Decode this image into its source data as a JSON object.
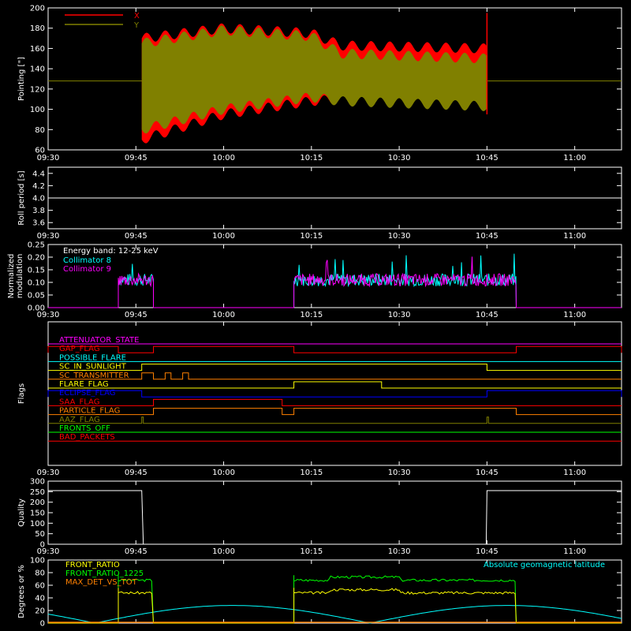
{
  "time_ticks": [
    "09:30",
    "09:45",
    "10:00",
    "10:15",
    "10:30",
    "10:45",
    "11:00"
  ],
  "chart_data": [
    {
      "id": "pointing",
      "type": "line",
      "ylabel": "Pointing [\"]",
      "ylim": [
        60,
        200
      ],
      "yticks": [
        60,
        80,
        100,
        120,
        140,
        160,
        180,
        200
      ],
      "x_range": [
        "09:30",
        "11:08"
      ],
      "series": [
        {
          "name": "X",
          "color": "#ff0000"
        },
        {
          "name": "Y",
          "color": "#808000"
        }
      ],
      "segments": [
        {
          "t": "09:46",
          "x_top": 170,
          "x_bottom": 70,
          "y_top": 165,
          "y_bottom": 80
        },
        {
          "t": "10:00",
          "x_top": 180,
          "x_bottom": 95,
          "y_top": 178,
          "y_bottom": 100
        },
        {
          "t": "10:15",
          "x_top": 175,
          "x_bottom": 108,
          "y_top": 172,
          "y_bottom": 112
        },
        {
          "t": "10:20",
          "x_top": 163,
          "x_bottom": 110,
          "y_top": 155,
          "y_bottom": 108
        },
        {
          "t": "10:45",
          "x_top": 160,
          "x_bottom": 105,
          "y_top": 150,
          "y_bottom": 103
        }
      ],
      "baseline": 128
    },
    {
      "id": "roll",
      "type": "line",
      "ylabel": "Roll period [s]",
      "ylim": [
        3.5,
        4.5
      ],
      "yticks": [
        3.6,
        3.8,
        4.0,
        4.2,
        4.4
      ],
      "value": 4.0
    },
    {
      "id": "modulation",
      "type": "line",
      "ylabel": "Normalized modulation",
      "ylim": [
        0,
        0.25
      ],
      "yticks": [
        0.0,
        0.05,
        0.1,
        0.15,
        0.2,
        0.25
      ],
      "title": "Energy band: 12-25 keV",
      "series": [
        {
          "name": "Collimator 8",
          "color": "#00ffff"
        },
        {
          "name": "Collimator 9",
          "color": "#ff00ff"
        }
      ],
      "active_intervals": [
        {
          "start": "09:42",
          "end": "09:48",
          "level": 0.11
        },
        {
          "start": "10:12",
          "end": "10:50",
          "level": 0.11
        }
      ]
    },
    {
      "id": "flags",
      "type": "line",
      "ylabel": "Flags",
      "flags": [
        {
          "name": "ATTENUATOR_STATE",
          "color": "#ff00ff",
          "high": []
        },
        {
          "name": "GAP_FLAG",
          "color": "#ff0000",
          "high": [
            [
              "09:30",
              "09:42"
            ],
            [
              "09:48",
              "10:12"
            ],
            [
              "10:50",
              "11:08"
            ]
          ]
        },
        {
          "name": "POSSIBLE_FLARE",
          "color": "#00ffff",
          "high": []
        },
        {
          "name": "SC_IN_SUNLIGHT",
          "color": "#ffff00",
          "high": [
            [
              "09:46",
              "10:45"
            ]
          ]
        },
        {
          "name": "SC_TRANSMITTER",
          "color": "#ff8000",
          "high": [
            [
              "09:46",
              "09:48"
            ],
            [
              "09:50",
              "09:51"
            ],
            [
              "09:53",
              "09:54"
            ]
          ]
        },
        {
          "name": "FLARE_FLAG",
          "color": "#ffff00",
          "high": [
            [
              "10:12",
              "10:27"
            ]
          ]
        },
        {
          "name": "ECLIPSE_FLAG",
          "color": "#0000ff",
          "high": [
            [
              "09:30",
              "09:46"
            ],
            [
              "10:45",
              "11:08"
            ]
          ]
        },
        {
          "name": "SAA_FLAG",
          "color": "#ff0000",
          "high": [
            [
              "09:48",
              "10:10"
            ]
          ]
        },
        {
          "name": "PARTICLE_FLAG",
          "color": "#ff8000",
          "high": [
            [
              "09:48",
              "10:10"
            ],
            [
              "10:12",
              "10:50"
            ]
          ]
        },
        {
          "name": "AAZ_FLAG",
          "color": "#808000",
          "high": [
            [
              "09:46",
              "09:46"
            ],
            [
              "10:45",
              "10:45"
            ]
          ]
        },
        {
          "name": "FRONTS_OFF",
          "color": "#00ff00",
          "high": []
        },
        {
          "name": "BAD_PACKETS",
          "color": "#ff0000",
          "high": []
        }
      ]
    },
    {
      "id": "quality",
      "type": "line",
      "ylabel": "Quality",
      "ylim": [
        0,
        300
      ],
      "yticks": [
        0,
        50,
        100,
        150,
        200,
        250,
        300
      ],
      "high_value": 255,
      "low_interval": [
        "09:46",
        "10:45"
      ]
    },
    {
      "id": "ratios",
      "type": "line",
      "ylabel": "Degrees or %",
      "ylim": [
        0,
        100
      ],
      "yticks": [
        0,
        20,
        40,
        60,
        80,
        100
      ],
      "series": [
        {
          "name": "FRONT_RATIO",
          "color": "#ffff00",
          "level": 48
        },
        {
          "name": "FRONT_RATIO_1225",
          "color": "#00ff00",
          "level": 68
        },
        {
          "name": "MAX_DET_VS_TOT",
          "color": "#ff8000",
          "level": 0
        },
        {
          "name": "Absolute geomagnetic latitude",
          "color": "#00ffff"
        }
      ],
      "active_intervals": [
        [
          "09:42",
          "09:48"
        ],
        [
          "10:12",
          "10:50"
        ]
      ],
      "latitude": {
        "min": 0,
        "max": 28,
        "minima_at": [
          "09:38",
          "10:25",
          "11:05"
        ],
        "maxima_at": [
          "10:00",
          "10:45"
        ]
      }
    }
  ]
}
